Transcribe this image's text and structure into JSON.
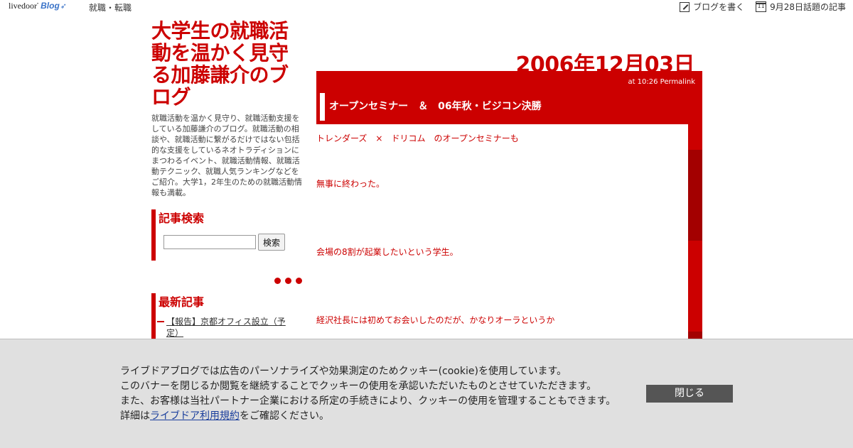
{
  "topbar": {
    "logo_main": "livedoor",
    "logo_blog": "Blog",
    "nav_label": "就職・転職",
    "write_label": "ブログを書く",
    "calendar_day": "11",
    "topic_label": "9月28日話題の記事"
  },
  "sidebar": {
    "title": "大学生の就職活動を温かく見守る加藤謙介のブログ",
    "description": "就職活動を温かく見守り、就職活動支援をしている加藤謙介のブログ。就職活動の相談や、就職活動に繋がるだけではない包括的な支援をしているネオトラディションにまつわるイベント、就職活動情報、就職活動テクニック、就職人気ランキングなどをご紹介。大学1，2年生のための就職活動情報も満載。",
    "search": {
      "heading": "記事検索",
      "button_label": "検索",
      "input_value": ""
    },
    "recent": {
      "heading": "最新記事",
      "items": [
        "【報告】京都オフィス設立（予定）"
      ]
    }
  },
  "main": {
    "date": "2006年12月03日",
    "post": {
      "meta": "at 10:26 Permalink",
      "title": "オープンセミナー　＆　06年秋・ビジコン決勝",
      "lines": [
        "トレンダーズ　×　ドリコム　のオープンセミナーも",
        "無事に終わった。",
        "会場の8割が起業したいという学生。",
        "経沢社長には初めてお会いしたのだが、かなりオーラというか"
      ]
    }
  },
  "cookie_banner": {
    "line1": "ライブドアブログでは広告のパーソナライズや効果測定のためクッキー(cookie)を使用しています。",
    "line2": "このバナーを閉じるか閲覧を継続することでクッキーの使用を承認いただいたものとさせていただきます。",
    "line3": "また、お客様は当社パートナー企業における所定の手続きにより、クッキーの使用を管理することもできます。",
    "line4_prefix": "詳細は",
    "line4_link": "ライブドア利用規約",
    "line4_suffix": "をご確認ください。",
    "close_label": "閉じる"
  },
  "colors": {
    "accent": "#cc0000",
    "accent_dark": "#a30000",
    "banner_bg": "#e0e0e0",
    "close_button_bg": "#555555",
    "link": "#1a3e9c"
  },
  "icons": [
    "pencil-edit-icon",
    "calendar-icon",
    "bullet-dots-icon"
  ]
}
